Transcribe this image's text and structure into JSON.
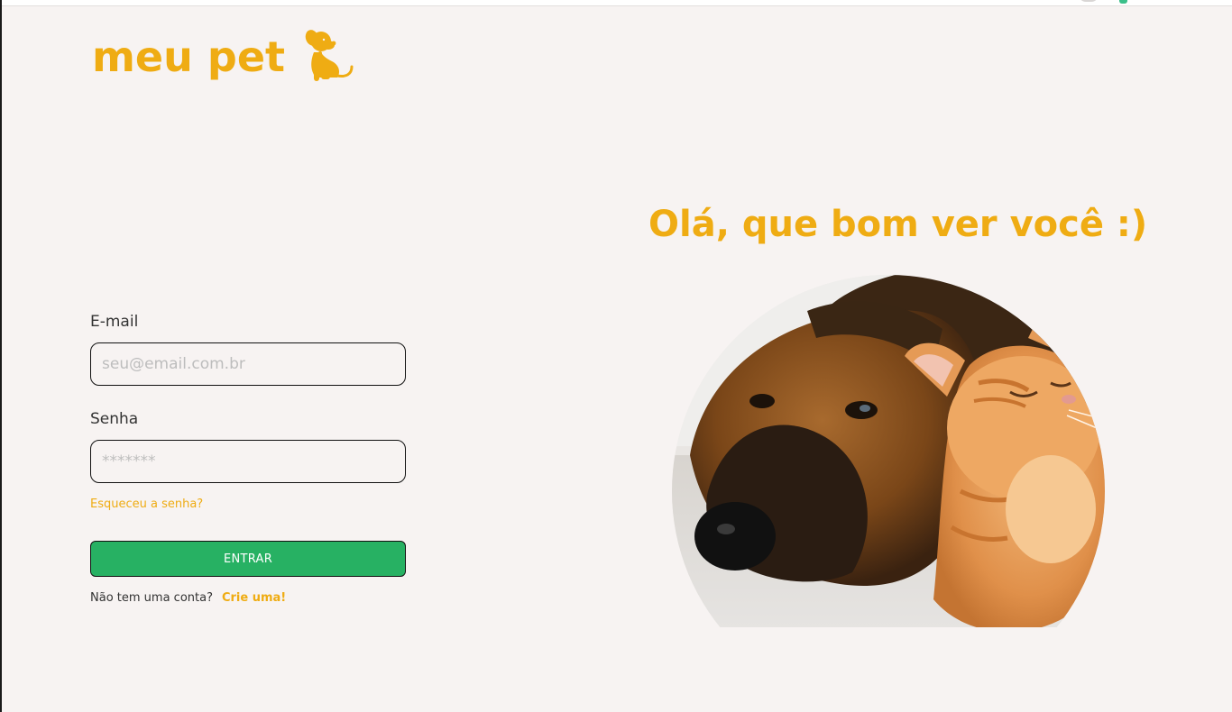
{
  "brand": {
    "name": "meu pet",
    "icon": "dog-icon",
    "color": "#efac13"
  },
  "hero": {
    "heading": "Olá, que bom ver você :)",
    "image": "dog-and-cat-photo"
  },
  "login_form": {
    "email_label": "E-mail",
    "email_placeholder": "seu@email.com.br",
    "password_label": "Senha",
    "password_placeholder": "*******",
    "forgot_link": "Esqueceu a senha?",
    "submit_label": "ENTRAR",
    "signup_prompt": "Não tem uma conta?",
    "signup_link": "Crie uma!"
  },
  "colors": {
    "accent": "#efac13",
    "primary_button": "#27b163",
    "background": "#f7f3f2"
  }
}
